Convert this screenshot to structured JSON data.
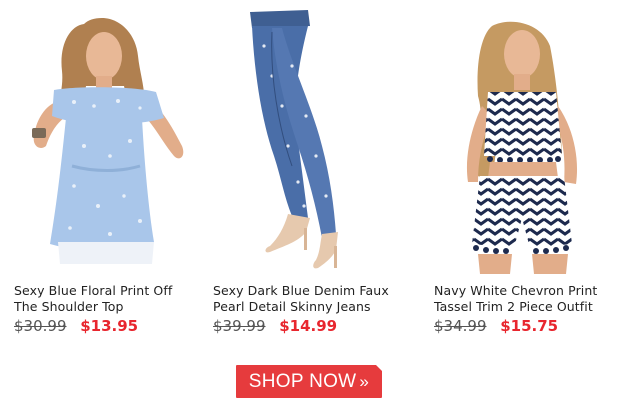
{
  "colors": {
    "accent": "#e8262e",
    "button_bg": "#e63b3d",
    "old_price": "#555555",
    "title_text": "#222222"
  },
  "products": [
    {
      "title_line1": "Sexy Blue Floral Print Off",
      "title_line2": "The Shoulder Top",
      "old_price": "$30.99",
      "new_price": "$13.95",
      "image_icon": "model-blue-floral-top-image"
    },
    {
      "title_line1": "Sexy Dark Blue Denim Faux",
      "title_line2": "Pearl Detail Skinny Jeans",
      "old_price": "$39.99",
      "new_price": "$14.99",
      "image_icon": "model-denim-jeans-image"
    },
    {
      "title_line1": "Navy White Chevron Print",
      "title_line2": "Tassel Trim 2 Piece Outfit",
      "old_price": "$34.99",
      "new_price": "$15.75",
      "image_icon": "model-chevron-outfit-image"
    }
  ],
  "cta": {
    "label": "SHOP NOW",
    "chevron": "»"
  }
}
